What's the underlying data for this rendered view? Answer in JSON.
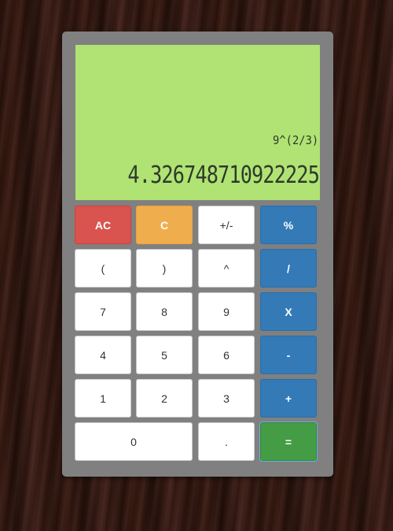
{
  "display": {
    "expression": "9^(2/3)",
    "result": "4.326748710922225"
  },
  "keys": {
    "ac": "AC",
    "c": "C",
    "sign": "+/-",
    "percent": "%",
    "open_paren": "(",
    "close_paren": ")",
    "power": "^",
    "divide": "/",
    "seven": "7",
    "eight": "8",
    "nine": "9",
    "multiply": "X",
    "four": "4",
    "five": "5",
    "six": "6",
    "minus": "-",
    "one": "1",
    "two": "2",
    "three": "3",
    "plus": "+",
    "zero": "0",
    "decimal": ".",
    "equals": "="
  },
  "colors": {
    "display_bg": "#b1e374",
    "body": "#808080",
    "clear_all": "#d9534f",
    "clear": "#f0ad4e",
    "operator": "#337ab7",
    "equals": "#449d44"
  }
}
